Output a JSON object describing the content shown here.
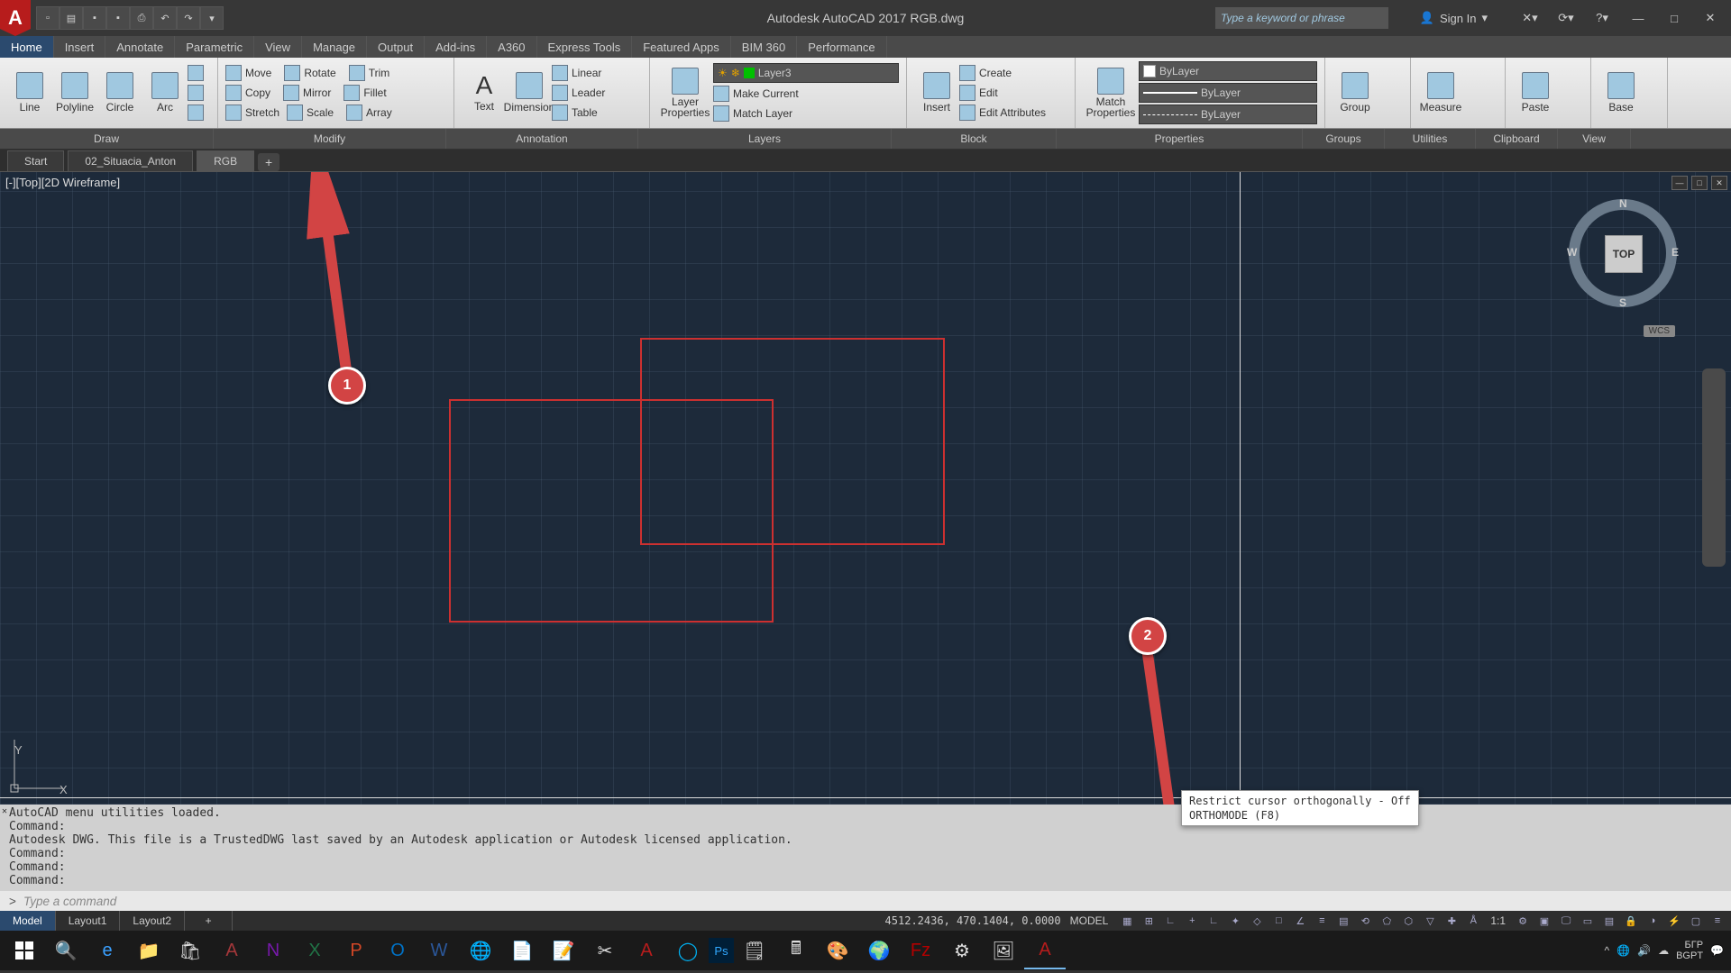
{
  "app": {
    "title": "Autodesk AutoCAD 2017   RGB.dwg"
  },
  "search": {
    "placeholder": "Type a keyword or phrase"
  },
  "signin": "Sign In",
  "menu_tabs": [
    "Home",
    "Insert",
    "Annotate",
    "Parametric",
    "View",
    "Manage",
    "Output",
    "Add-ins",
    "A360",
    "Express Tools",
    "Featured Apps",
    "BIM 360",
    "Performance"
  ],
  "panels": {
    "draw": {
      "name": "Draw",
      "buttons": [
        "Line",
        "Polyline",
        "Circle",
        "Arc"
      ]
    },
    "modify": {
      "name": "Modify",
      "rows": [
        [
          "Move",
          "Rotate",
          "Trim"
        ],
        [
          "Copy",
          "Mirror",
          "Fillet"
        ],
        [
          "Stretch",
          "Scale",
          "Array"
        ]
      ]
    },
    "annotation": {
      "name": "Annotation",
      "big": [
        "Text",
        "Dimension"
      ],
      "small": [
        "Linear",
        "Leader",
        "Table"
      ]
    },
    "layers": {
      "name": "Layers",
      "big": "Layer Properties",
      "actions": [
        "Make Current",
        "Match Layer"
      ],
      "combo": "Layer3"
    },
    "block": {
      "name": "Block",
      "big": "Insert",
      "small": [
        "Create",
        "Edit",
        "Edit Attributes"
      ]
    },
    "properties": {
      "name": "Properties",
      "big": "Match Properties",
      "combo": "ByLayer"
    },
    "groups": {
      "name": "Groups",
      "big": "Group"
    },
    "utilities": {
      "name": "Utilities",
      "big": "Measure"
    },
    "clipboard": {
      "name": "Clipboard",
      "big": "Paste"
    },
    "view": {
      "name": "View",
      "big": "Base"
    }
  },
  "filetabs": [
    "Start",
    "02_Situacia_Anton",
    "RGB"
  ],
  "active_file": "RGB",
  "viewport_label": "[-][Top][2D Wireframe]",
  "navcube": {
    "face": "TOP",
    "n": "N",
    "s": "S",
    "e": "E",
    "w": "W"
  },
  "wcs": "WCS",
  "ucs": {
    "y": "Y",
    "x": "X"
  },
  "markers": {
    "m1": "1",
    "m2": "2"
  },
  "tooltip": {
    "line1": "Restrict cursor orthogonally - Off",
    "line2": "ORTHOMODE (F8)"
  },
  "cmdlog": [
    "AutoCAD menu utilities loaded.",
    "Command:",
    "Autodesk DWG.  This file is a TrustedDWG last saved by an Autodesk application or Autodesk licensed application.",
    "Command:",
    "Command:",
    "Command:"
  ],
  "cmd_placeholder": "Type a command",
  "layout_tabs": [
    "Model",
    "Layout1",
    "Layout2"
  ],
  "status": {
    "coords": "4512.2436, 470.1404, 0.0000",
    "space": "MODEL",
    "scale": "1:1"
  },
  "tray": {
    "lang1": "БГР",
    "lang2": "BGPT"
  }
}
